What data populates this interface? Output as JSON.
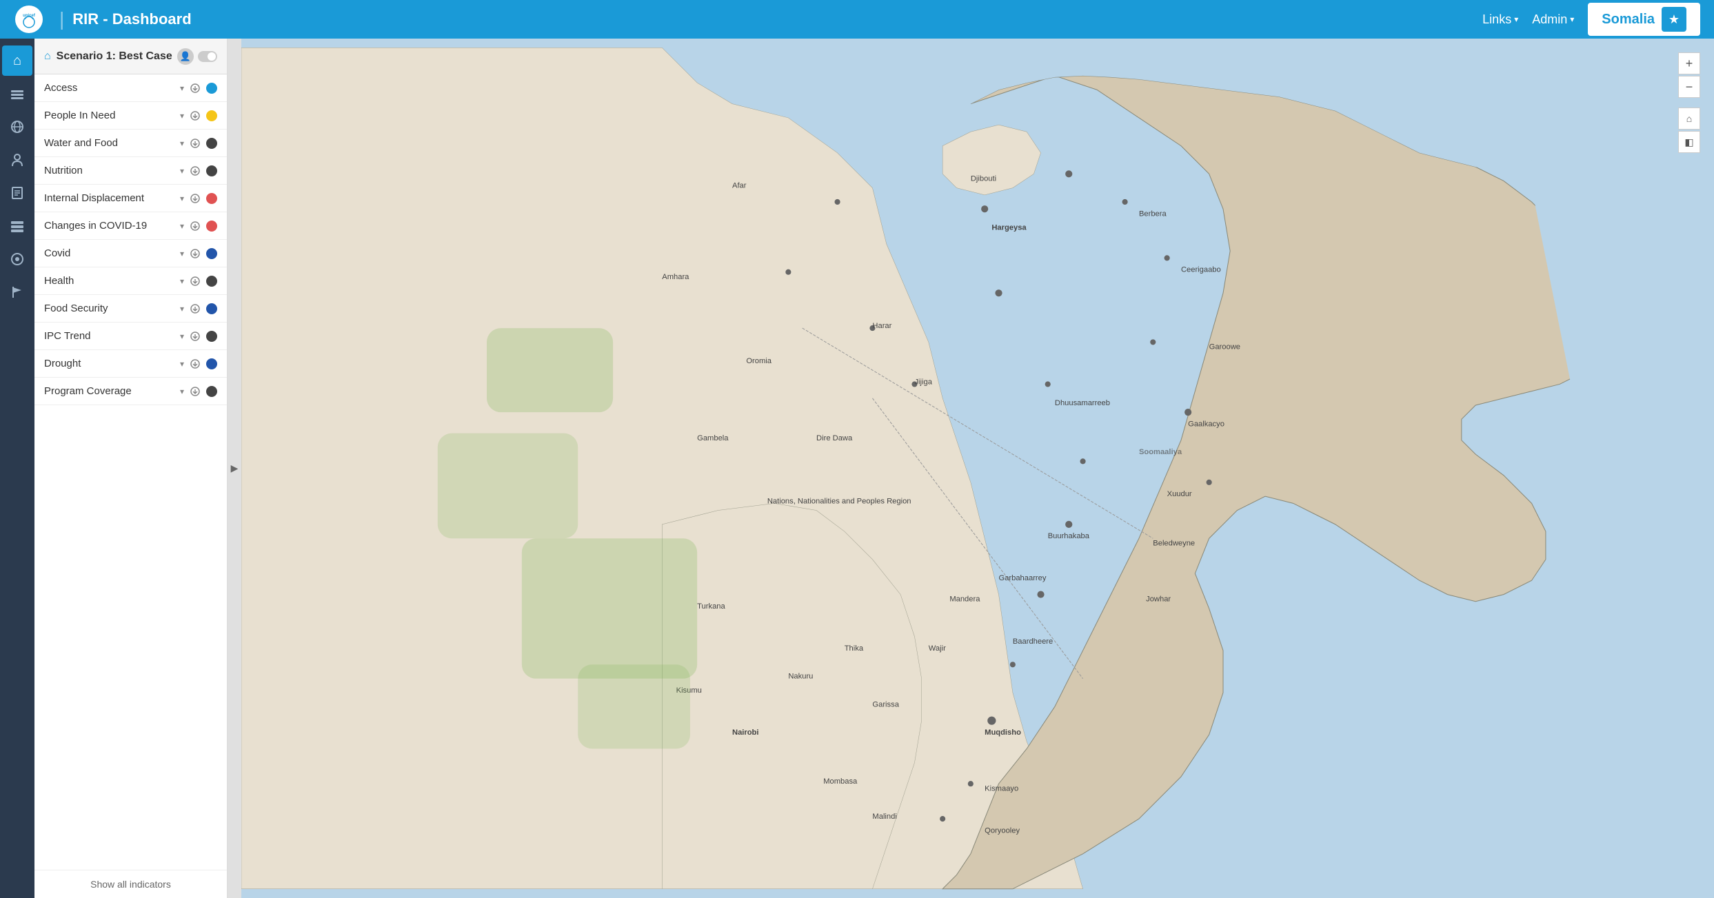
{
  "navbar": {
    "brand": "RIR - Dashboard",
    "unicef_label": "unicef",
    "separator": "|",
    "links_label": "Links",
    "admin_label": "Admin",
    "country_label": "Somalia"
  },
  "scenario": {
    "title": "Scenario 1: Best Case"
  },
  "layers": [
    {
      "id": "access",
      "name": "Access",
      "dot_color": "blue"
    },
    {
      "id": "people-in-need",
      "name": "People In Need",
      "dot_color": "yellow"
    },
    {
      "id": "water-and-food",
      "name": "Water and Food",
      "dot_color": "dark"
    },
    {
      "id": "nutrition",
      "name": "Nutrition",
      "dot_color": "dark"
    },
    {
      "id": "internal-displacement",
      "name": "Internal Displacement",
      "dot_color": "red"
    },
    {
      "id": "changes-in-covid",
      "name": "Changes in COVID-19",
      "dot_color": "red"
    },
    {
      "id": "covid",
      "name": "Covid",
      "dot_color": "dark-blue"
    },
    {
      "id": "health",
      "name": "Health",
      "dot_color": "dark"
    },
    {
      "id": "food-security",
      "name": "Food Security",
      "dot_color": "dark-blue"
    },
    {
      "id": "ipc-trend",
      "name": "IPC Trend",
      "dot_color": "dark"
    },
    {
      "id": "drought",
      "name": "Drought",
      "dot_color": "dark-blue"
    },
    {
      "id": "program-coverage",
      "name": "Program Coverage",
      "dot_color": "dark"
    }
  ],
  "show_all_label": "Show all indicators",
  "left_nav": [
    {
      "id": "home",
      "icon": "⌂",
      "active": true
    },
    {
      "id": "layers",
      "icon": "◫",
      "active": false
    },
    {
      "id": "globe",
      "icon": "◎",
      "active": false
    },
    {
      "id": "people",
      "icon": "👤",
      "active": false
    },
    {
      "id": "book",
      "icon": "📖",
      "active": false
    },
    {
      "id": "list",
      "icon": "≡",
      "active": false
    },
    {
      "id": "network",
      "icon": "🌐",
      "active": false
    },
    {
      "id": "flag",
      "icon": "⚑",
      "active": false
    }
  ]
}
